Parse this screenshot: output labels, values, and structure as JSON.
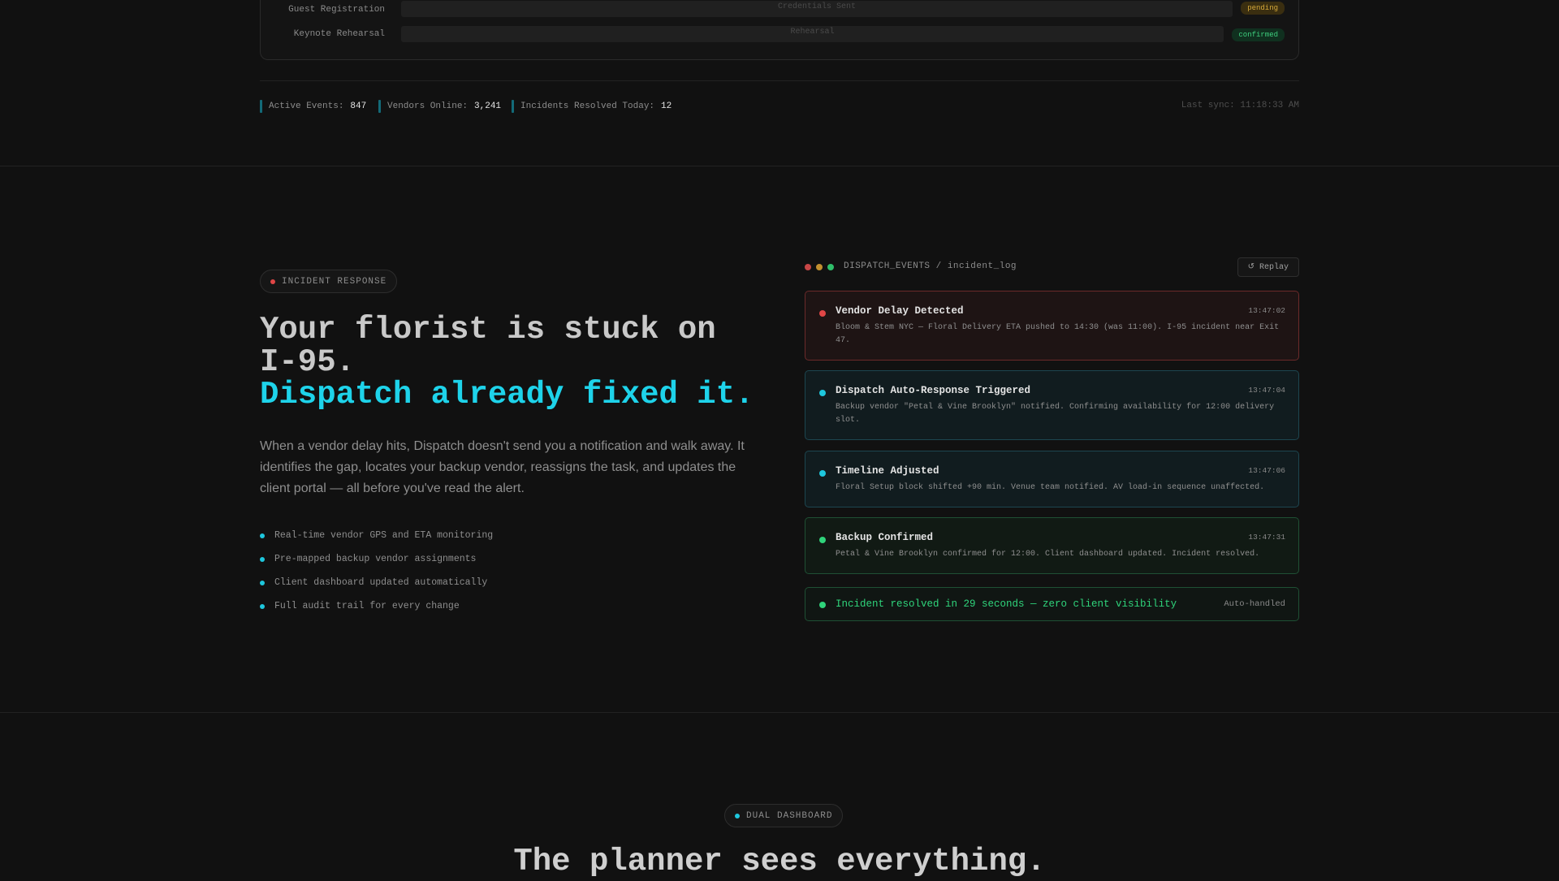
{
  "timeline": {
    "rows": [
      {
        "label": "Guest Registration",
        "bar_text": "Credentials Sent",
        "status": "pending"
      },
      {
        "label": "Keynote Rehearsal",
        "bar_text": "Rehearsal",
        "status": "confirmed"
      }
    ]
  },
  "stats": {
    "active_events_label": "Active Events:",
    "active_events_value": "847",
    "vendors_online_label": "Vendors Online:",
    "vendors_online_value": "3,241",
    "incidents_label": "Incidents Resolved Today:",
    "incidents_value": "12",
    "last_sync": "Last sync: 11:18:33 AM"
  },
  "incident_section": {
    "pill_label": "INCIDENT RESPONSE",
    "headline_line1": "Your florist is stuck on I-95.",
    "headline_accent": "Dispatch already fixed it.",
    "lead": "When a vendor delay hits, Dispatch doesn't send you a notification and walk away. It identifies the gap, locates your backup vendor, reassigns the task, and updates the client portal — all before you've read the alert.",
    "features": [
      "Real-time vendor GPS and ETA monitoring",
      "Pre-mapped backup vendor assignments",
      "Client dashboard updated automatically",
      "Full audit trail for every change"
    ]
  },
  "log": {
    "path": "DISPATCH_EVENTS / incident_log",
    "replay_icon": "↺",
    "replay_label": "Replay",
    "events": [
      {
        "title": "Vendor Delay Detected",
        "time": "13:47:02",
        "desc": "Bloom & Stem NYC — Floral Delivery ETA pushed to 14:30 (was 11:00). I-95 incident near Exit 47."
      },
      {
        "title": "Dispatch Auto-Response Triggered",
        "time": "13:47:04",
        "desc": "Backup vendor \"Petal & Vine Brooklyn\" notified. Confirming availability for 12:00 delivery slot."
      },
      {
        "title": "Timeline Adjusted",
        "time": "13:47:06",
        "desc": "Floral Setup block shifted +90 min. Venue team notified. AV load-in sequence unaffected."
      },
      {
        "title": "Backup Confirmed",
        "time": "13:47:31",
        "desc": "Petal & Vine Brooklyn confirmed for 12:00. Client dashboard updated. Incident resolved."
      }
    ],
    "resolved_text": "Incident resolved in 29 seconds — zero client visibility",
    "resolved_tag": "Auto-handled"
  },
  "dashboard_section": {
    "pill_label": "DUAL DASHBOARD",
    "title": "The planner sees everything."
  },
  "colors": {
    "accent_cyan": "#1ed3ea",
    "alert_red": "#e04646",
    "success_green": "#2fd47b",
    "warning_amber": "#d6a93a"
  }
}
